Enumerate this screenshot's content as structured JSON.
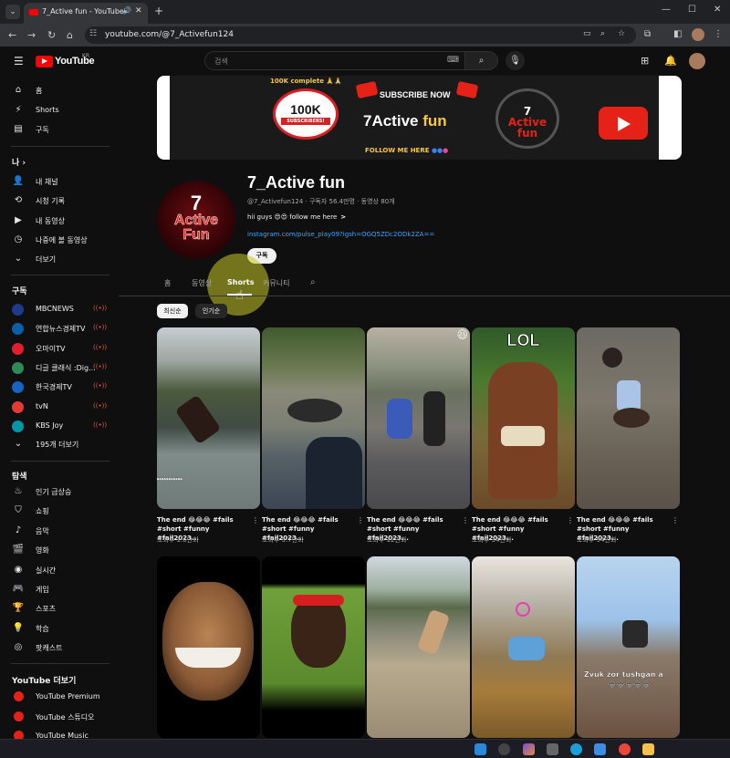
{
  "browser": {
    "tab_title": "7_Active fun - YouTube",
    "url": "youtube.com/@7_Activefun124",
    "new_tab_icon": "+",
    "window_controls": [
      "minimize",
      "maximize",
      "close"
    ]
  },
  "masthead": {
    "logo_text": "YouTube",
    "region": "KR",
    "search_placeholder": "검색"
  },
  "sidebar": {
    "main_items": [
      {
        "label": "홈",
        "icon": "home-icon"
      },
      {
        "label": "Shorts",
        "icon": "shorts-icon"
      },
      {
        "label": "구독",
        "icon": "subscriptions-icon"
      }
    ],
    "you_header": "나",
    "you_items": [
      {
        "label": "내 채널",
        "icon": "channel-icon"
      },
      {
        "label": "시청 기록",
        "icon": "history-icon"
      },
      {
        "label": "내 동영상",
        "icon": "videos-icon"
      },
      {
        "label": "나중에 볼 동영상",
        "icon": "clock-icon"
      },
      {
        "label": "더보기",
        "icon": "chevron-down-icon"
      }
    ],
    "subs_header": "구독",
    "subs": [
      {
        "label": "MBCNEWS",
        "color": "#1e3a8a"
      },
      {
        "label": "연합뉴스경제TV",
        "color": "#0b5fa8"
      },
      {
        "label": "오마이TV",
        "color": "#e11d2e"
      },
      {
        "label": "디글 클래식 :Dig...",
        "color": "#2e8b57"
      },
      {
        "label": "한국경제TV",
        "color": "#1565c0"
      },
      {
        "label": "tvN",
        "color": "#e53935"
      },
      {
        "label": "KBS Joy",
        "color": "#0097a7"
      }
    ],
    "subs_more": "195개 더보기",
    "explore_header": "탐색",
    "explore_items": [
      {
        "label": "인기 급상승",
        "icon": "fire-icon"
      },
      {
        "label": "쇼핑",
        "icon": "shopping-bag-icon"
      },
      {
        "label": "음악",
        "icon": "music-icon"
      },
      {
        "label": "영화",
        "icon": "film-icon"
      },
      {
        "label": "실시간",
        "icon": "live-icon"
      },
      {
        "label": "게임",
        "icon": "gamepad-icon"
      },
      {
        "label": "스포츠",
        "icon": "trophy-icon"
      },
      {
        "label": "학습",
        "icon": "bulb-icon"
      },
      {
        "label": "팟캐스트",
        "icon": "podcast-icon"
      }
    ],
    "more_header": "YouTube 더보기",
    "more_items": [
      {
        "label": "YouTube Premium"
      },
      {
        "label": "YouTube 스튜디오"
      },
      {
        "label": "YouTube Music"
      }
    ]
  },
  "banner": {
    "complete_text": "100K complete 🙏🙏",
    "badge_num": "100K",
    "badge_sub": "SUBSCRIBERS!",
    "subscribe_text": "SUBSCRIBE NOW",
    "title_a": "7Active",
    "title_b": "fun",
    "follow_text": "FOLLOW ME HERE",
    "logo_top": "7",
    "logo_mid": "Active",
    "logo_bot": "fun"
  },
  "channel": {
    "avatar_top": "7",
    "avatar_mid": "Active",
    "avatar_bot": "Fun",
    "name": "7_Active fun",
    "meta": "@7_Activefun124 · 구독자 56.4만명 · 동영상 80개",
    "description": "hii guys 😍😍 follow me here",
    "desc_more": ">",
    "link": "instagram.com/pulse_play09?igsh=OGQ5ZDc2ODk2ZA==",
    "subscribe_label": "구독"
  },
  "tabs": [
    {
      "label": "홈"
    },
    {
      "label": "동영상"
    },
    {
      "label": "Shorts"
    },
    {
      "label": "커뮤니티"
    }
  ],
  "chips": [
    {
      "label": "최신순",
      "active": true
    },
    {
      "label": "인기순",
      "active": false
    }
  ],
  "shorts_row1": [
    {
      "title": "The end 😂😂😂 #fails #short #funny #fail2023...",
      "views": "조회수 1.6만회",
      "caption": "▸▸▸▸▸▸▸▸▸▸▸"
    },
    {
      "title": "The end 😂😂😂 #fails #short #funny #fail2023...",
      "views": "조회수 9.7만회"
    },
    {
      "title": "The end 😂😂😂 #fails #short #funny #fail2023...",
      "views": "조회수 12만회",
      "emoji": "😆"
    },
    {
      "title": "The end 😂😂😂 #fails #short #funny #fail2023...",
      "views": "조회수 34만회",
      "overlay": "LOL"
    },
    {
      "title": "The end 😂😂😂 #fails #short #funny #fail2023...",
      "views": "조회수 94만회"
    }
  ],
  "shorts_row2": [
    {
      "title": ""
    },
    {
      "title": ""
    },
    {
      "title": ""
    },
    {
      "title": ""
    },
    {
      "title": "",
      "caption": "Zvuk zor tushgan a",
      "caption_emoji": "😂😂😂😂😂"
    }
  ],
  "colors": {
    "accent_red": "#ff0000",
    "link_blue": "#3ea6ff",
    "background": "#0f0f0f"
  }
}
